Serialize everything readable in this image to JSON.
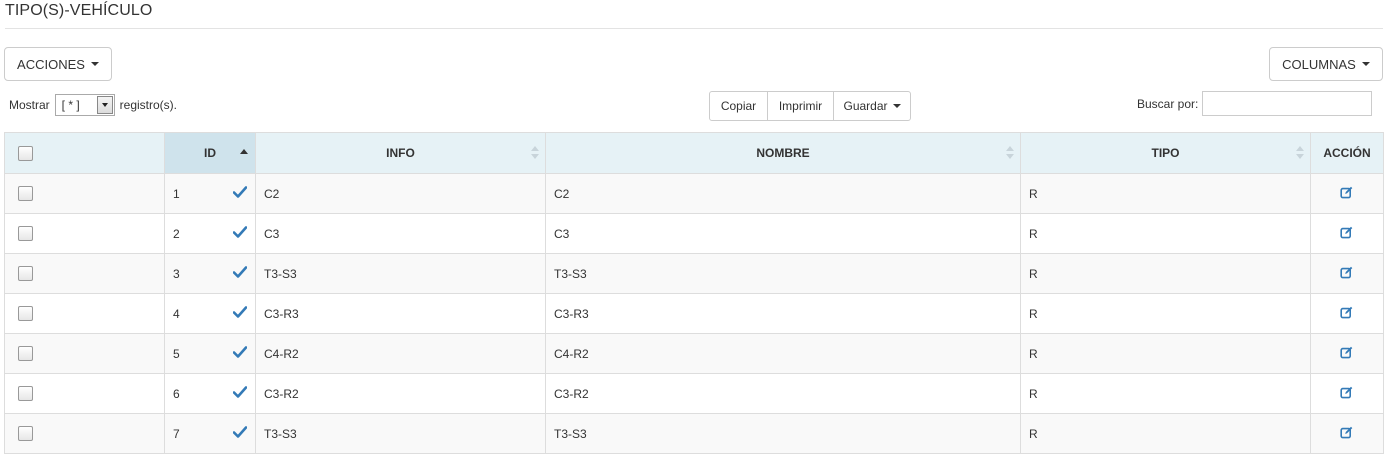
{
  "page": {
    "title": "TIPO(S)-VEHÍCULO"
  },
  "toolbar": {
    "acciones_label": "ACCIONES",
    "columnas_label": "COLUMNAS",
    "mostrar_label": "Mostrar",
    "mostrar_value": "[ * ]",
    "registros_label": "registro(s).",
    "copiar_label": "Copiar",
    "imprimir_label": "Imprimir",
    "guardar_label": "Guardar",
    "buscar_label": "Buscar por:",
    "buscar_value": ""
  },
  "table": {
    "headers": {
      "id": "ID",
      "info": "INFO",
      "nombre": "NOMBRE",
      "tipo": "TIPO",
      "accion": "ACCIÓN"
    },
    "rows": [
      {
        "id": "1",
        "info": "C2",
        "nombre": "C2",
        "tipo": "R"
      },
      {
        "id": "2",
        "info": "C3",
        "nombre": "C3",
        "tipo": "R"
      },
      {
        "id": "3",
        "info": "T3-S3",
        "nombre": "T3-S3",
        "tipo": "R"
      },
      {
        "id": "4",
        "info": "C3-R3",
        "nombre": "C3-R3",
        "tipo": "R"
      },
      {
        "id": "5",
        "info": "C4-R2",
        "nombre": "C4-R2",
        "tipo": "R"
      },
      {
        "id": "6",
        "info": "C3-R2",
        "nombre": "C3-R2",
        "tipo": "R"
      },
      {
        "id": "7",
        "info": "T3-S3",
        "nombre": "T3-S3",
        "tipo": "R"
      }
    ]
  },
  "colors": {
    "accent": "#337ab7",
    "header_bg": "#e6f2f6",
    "sorted_header_bg": "#cfe3ec"
  },
  "icons": {
    "row_status": "check-icon",
    "row_action": "edit-icon"
  }
}
